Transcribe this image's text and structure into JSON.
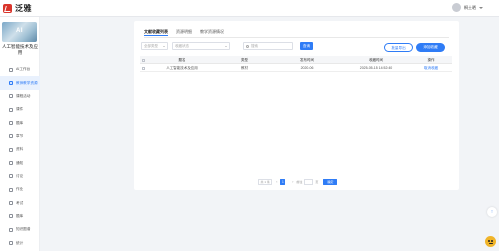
{
  "header": {
    "logo_text": "泛雅",
    "user_name": "桐土晒"
  },
  "sidebar": {
    "cover_text": "AI",
    "course_title": "人工智能技术及应用",
    "items": [
      {
        "label": "AI工作台",
        "active": false
      },
      {
        "label": "教师教学资源",
        "active": true
      },
      {
        "label": "课程活动",
        "active": false
      },
      {
        "label": "课件",
        "active": false
      },
      {
        "label": "题库",
        "active": false
      },
      {
        "label": "章节",
        "active": false
      },
      {
        "label": "资料",
        "active": false
      },
      {
        "label": "通知",
        "active": false
      },
      {
        "label": "讨论",
        "active": false
      },
      {
        "label": "作业",
        "active": false
      },
      {
        "label": "考试",
        "active": false
      },
      {
        "label": "题库",
        "active": false
      },
      {
        "label": "知识图谱",
        "active": false
      },
      {
        "label": "统计",
        "active": false
      }
    ]
  },
  "tabs": [
    {
      "label": "文献收藏列表",
      "active": true
    },
    {
      "label": "资源明细",
      "active": false
    },
    {
      "label": "教学资源情况",
      "active": false
    }
  ],
  "filters": {
    "select_type_placeholder": "全部类型",
    "select_status_placeholder": "收藏状态",
    "search_placeholder": "搜索",
    "query_button": "查询"
  },
  "actions": {
    "batch_export": "批量导出",
    "add_favorite": "添加收藏"
  },
  "table": {
    "columns": [
      "题名",
      "类型",
      "发布时间",
      "收藏时间",
      "操作"
    ],
    "rows": [
      {
        "title": "人工智能技术及应用",
        "type": "教材",
        "publish_time": "2020-06",
        "collect_time": "2025-05-15 14:52:40",
        "action": "取消收藏"
      }
    ]
  },
  "pagination": {
    "total_text": "共 1 条",
    "prev": "‹",
    "page": "1",
    "next": "›",
    "goto_label": "前往",
    "page_unit": "页",
    "confirm": "确定"
  },
  "floating": {
    "up_arrow": "↑"
  },
  "colors": {
    "primary": "#2f7cf6",
    "logo": "#d9342b",
    "bot": "#f0b429"
  }
}
